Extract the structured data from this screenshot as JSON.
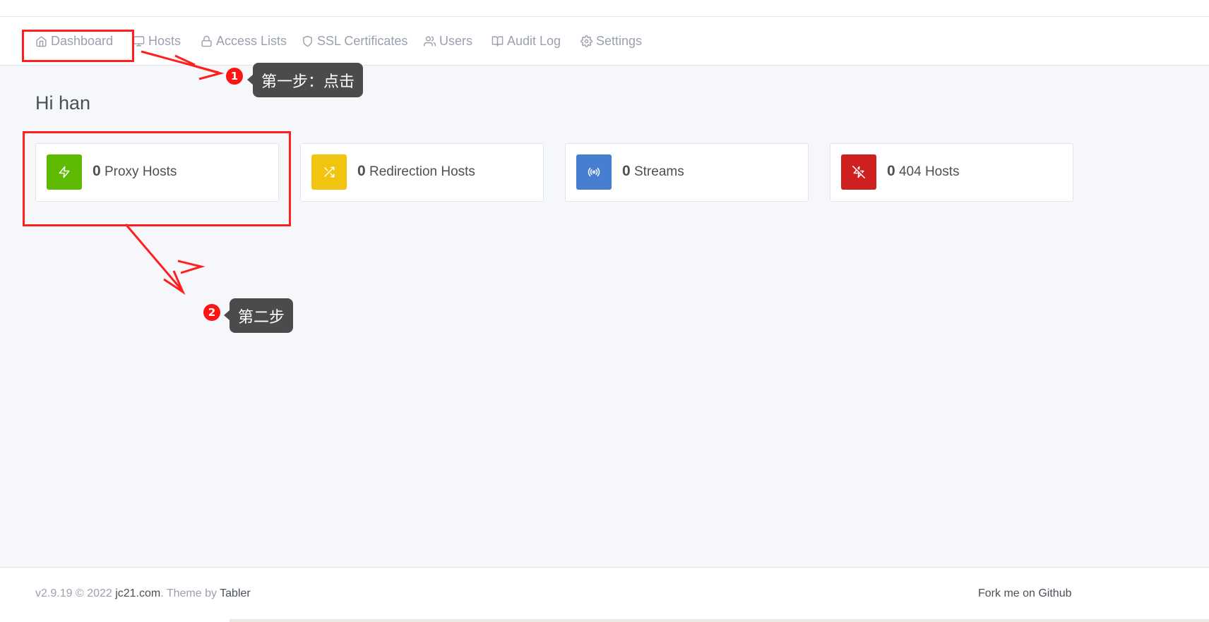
{
  "nav": {
    "items": [
      {
        "label": "Dashboard",
        "icon": "home-icon"
      },
      {
        "label": "Hosts",
        "icon": "monitor-icon"
      },
      {
        "label": "Access Lists",
        "icon": "lock-icon"
      },
      {
        "label": "SSL Certificates",
        "icon": "shield-icon"
      },
      {
        "label": "Users",
        "icon": "users-icon"
      },
      {
        "label": "Audit Log",
        "icon": "book-open-icon"
      },
      {
        "label": "Settings",
        "icon": "settings-icon"
      }
    ]
  },
  "greeting": "Hi han",
  "stats": [
    {
      "count": "0",
      "label": "Proxy Hosts",
      "icon": "zap-icon",
      "color": "#5eba00"
    },
    {
      "count": "0",
      "label": "Redirection Hosts",
      "icon": "shuffle-icon",
      "color": "#f1c40f"
    },
    {
      "count": "0",
      "label": "Streams",
      "icon": "radio-icon",
      "color": "#467fcf"
    },
    {
      "count": "0",
      "label": "404 Hosts",
      "icon": "zap-off-icon",
      "color": "#cd201f"
    }
  ],
  "footer": {
    "version": "v2.9.19 © 2022",
    "company_link": "jc21.com",
    "theme_text": ". Theme by",
    "theme_link": "Tabler",
    "github_link": "Fork me on Github"
  },
  "annotations": {
    "step1": {
      "number": "1",
      "text": "第一步：点击"
    },
    "step2": {
      "number": "2",
      "text": "第二步"
    },
    "highlight_color": "#ff1f1f"
  }
}
